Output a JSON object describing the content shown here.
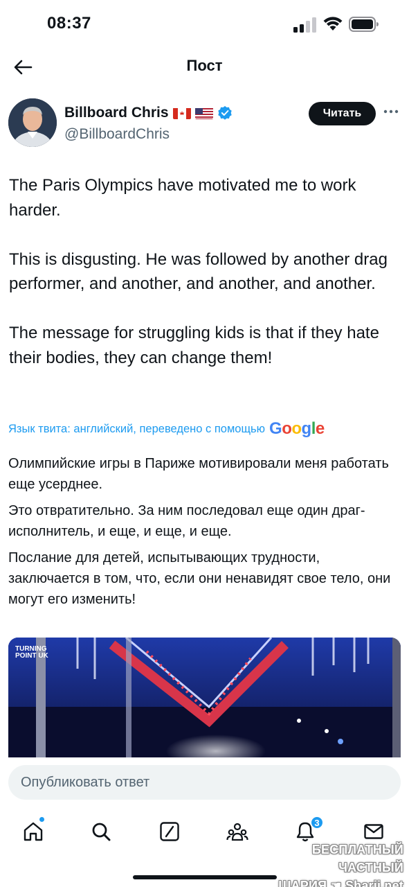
{
  "status_bar": {
    "time": "08:37"
  },
  "header": {
    "title": "Пост"
  },
  "author": {
    "name": "Billboard Chris",
    "flags": [
      "canada-flag-icon",
      "usa-flag-icon"
    ],
    "handle": "@BillboardChris",
    "verified": true,
    "follow_label": "Читать"
  },
  "tweet": {
    "paragraphs": [
      "The Paris Olympics have motivated me to work harder.",
      "This is disgusting. He was followed by another drag performer, and another, and another, and another.",
      "The message for struggling kids is that if they hate their bodies, they can change them!"
    ],
    "translate_label": "Язык твита: английский, переведено с помощью",
    "translate_provider": "Google",
    "translation": [
      "Олимпийские игры в Париже мотивировали меня работать еще усерднее.",
      "Это отвратительно. За ним последовал еще один драг-исполнитель, и еще, и еще, и еще.",
      "Послание для детей, испытывающих трудности, заключается в том, что, если они ненавидят свое тело, они могут его изменить!"
    ],
    "media_logo": "TURNING POINT UK"
  },
  "reply": {
    "placeholder": "Опубликовать ответ"
  },
  "tab_bar": {
    "items": [
      "home-icon",
      "search-icon",
      "grok-icon",
      "communities-icon",
      "notifications-icon",
      "messages-icon"
    ],
    "notifications_count": "3"
  },
  "watermark": {
    "line1": "БЕСПЛАТНЫЙ ЧАСТНЫЙ",
    "line2": "ШАРИЯ",
    "line3": "Sharij.net"
  },
  "colors": {
    "accent": "#1d9bf0",
    "text": "#0f1419",
    "secondary": "#536471",
    "button_bg": "#0f1419"
  }
}
